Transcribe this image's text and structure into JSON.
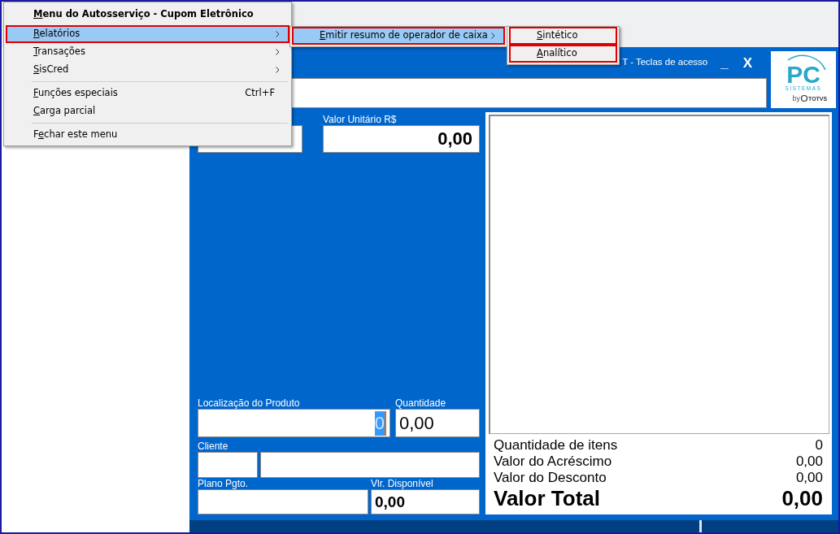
{
  "main_menu": {
    "title": {
      "key": "M",
      "rest": "enu do Autosserviço - Cupom Eletrônico"
    },
    "items": [
      {
        "kind": "submenu",
        "label": {
          "key": "R",
          "rest": "elatórios"
        },
        "selected": true,
        "highlighted": true
      },
      {
        "kind": "submenu",
        "label": {
          "key": "T",
          "rest": "ransações"
        },
        "selected": false,
        "highlighted": false
      },
      {
        "kind": "submenu",
        "label": {
          "key": "S",
          "rest": "isCred"
        },
        "selected": false,
        "highlighted": false
      },
      {
        "kind": "separator"
      },
      {
        "kind": "command",
        "label": {
          "key": "F",
          "rest": "unções especiais"
        },
        "shortcut": "Ctrl+F",
        "selected": false,
        "highlighted": false
      },
      {
        "kind": "command",
        "label": {
          "key": "C",
          "rest": "arga parcial"
        },
        "selected": false,
        "highlighted": false
      },
      {
        "kind": "separator"
      },
      {
        "kind": "command",
        "label": {
          "before": "F",
          "key": "e",
          "rest": "char este menu"
        },
        "selected": false,
        "highlighted": false
      }
    ]
  },
  "report_submenu": {
    "items": [
      {
        "kind": "submenu",
        "label": {
          "key": "E",
          "rest": "mitir resumo de operador de caixa"
        },
        "selected": true,
        "highlighted": true
      }
    ]
  },
  "summary_submenu": {
    "items": [
      {
        "label": {
          "key": "S",
          "rest": "intético"
        },
        "selected": false,
        "highlighted": true
      },
      {
        "label": {
          "key": "A",
          "rest": "nalítico"
        },
        "selected": false,
        "highlighted": true
      }
    ]
  },
  "header": {
    "shortcuts_hint": "T - Teclas de acesso",
    "minimize": "_",
    "close": "X"
  },
  "logo": {
    "mark": "PC",
    "name": "SISTEMAS",
    "by": "by",
    "brand": "TOTVS"
  },
  "unit_price": {
    "label": "Valor Unitário R$",
    "value": "0,00"
  },
  "product_location": {
    "label": "Localização do Produto",
    "value": "0"
  },
  "quantity": {
    "label": "Quantidade",
    "value": "0,00"
  },
  "customer": {
    "label": "Cliente"
  },
  "payment_plan": {
    "label": "Plano Pgto."
  },
  "available": {
    "label": "Vlr. Disponível",
    "value": "0,00"
  },
  "totals": [
    {
      "kind": "line",
      "label": "Quantidade de itens",
      "value": "0"
    },
    {
      "kind": "line",
      "label": "Valor do Acréscimo",
      "value": "0,00"
    },
    {
      "kind": "line",
      "label": "Valor do Desconto",
      "value": "0,00"
    },
    {
      "kind": "grand",
      "label": "Valor Total",
      "value": "0,00"
    }
  ]
}
